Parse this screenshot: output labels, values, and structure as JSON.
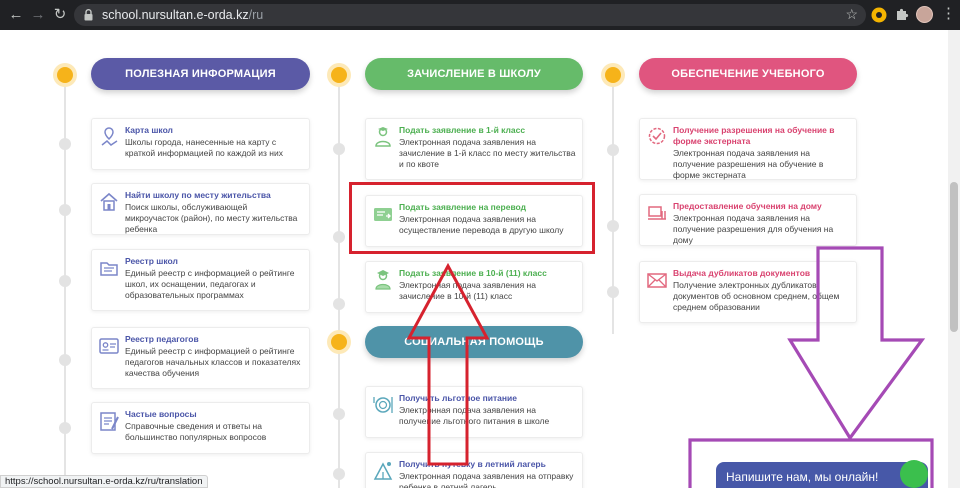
{
  "browser": {
    "url_host": "school.nursultan.e-orda.kz",
    "url_path": "/ru",
    "status_url": "https://school.nursultan.e-orda.kz/ru/translation"
  },
  "colors": {
    "blue_pill": "#5b5aa6",
    "green_pill": "#66bb6a",
    "pink_pill": "#e0557f",
    "teal_pill": "#4f93a8",
    "accent_dot": "#f6b31a",
    "red_outline": "#d6222e",
    "purple_annotation": "#a54ab5"
  },
  "columns": [
    {
      "title": "ПОЛЕЗНАЯ ИНФОРМАЦИЯ",
      "cards": [
        {
          "icon": "map-icon",
          "title": "Карта школ",
          "desc": "Школы города, нанесенные на карту с краткой информацией по каждой из них"
        },
        {
          "icon": "house-icon",
          "title": "Найти школу по месту жительства",
          "desc": "Поиск школы, обслуживающей микроучасток (район), по месту жительства ребенка"
        },
        {
          "icon": "folder-icon",
          "title": "Реестр школ",
          "desc": "Единый реестр с информацией о рейтинге школ, их оснащении, педагогах и образовательных программах"
        },
        {
          "icon": "id-card-icon",
          "title": "Реестр педагогов",
          "desc": "Единый реестр с информацией о рейтинге педагогов начальных классов и показателях качества обучения"
        },
        {
          "icon": "faq-icon",
          "title": "Частые вопросы",
          "desc": "Справочные сведения и ответы на большинство популярных вопросов"
        }
      ]
    },
    {
      "title": "ЗАЧИСЛЕНИЕ В ШКОЛУ",
      "cards": [
        {
          "icon": "student-icon",
          "title": "Подать заявление в 1-й класс",
          "desc": "Электронная подача заявления на зачисление в 1-й класс по месту жительства и по квоте"
        },
        {
          "icon": "transfer-icon",
          "title": "Подать заявление на перевод",
          "desc": "Электронная подача заявления на осуществление перевода в другую школу"
        },
        {
          "icon": "graduate-icon",
          "title": "Подать заявление в 10-й (11) класс",
          "desc": "Электронная подача заявления на зачисление в 10-й (11) класс"
        }
      ]
    },
    {
      "title": "ОБЕСПЕЧЕНИЕ УЧЕБНОГО ПРОЦЕССА",
      "cards": [
        {
          "icon": "external-study-icon",
          "title": "Получение разрешения на обучение в форме экстерната",
          "desc": "Электронная подача заявления на получение разрешения на обучение в форме экстерната"
        },
        {
          "icon": "home-study-icon",
          "title": "Предоставление обучения на дому",
          "desc": "Электронная подача заявления на получение разрешения для обучения на дому"
        },
        {
          "icon": "envelope-icon",
          "title": "Выдача дубликатов документов",
          "desc": "Получение электронных дубликатов документов об основном среднем, общем среднем образовании"
        }
      ]
    }
  ],
  "social": {
    "title": "СОЦИАЛЬНАЯ ПОМОЩЬ",
    "cards": [
      {
        "icon": "meal-icon",
        "title": "Получить льготное питание",
        "desc": "Электронная подача заявления на получение льготного питания в школе"
      },
      {
        "icon": "camp-icon",
        "title": "Получить путевку в летний лагерь",
        "desc": "Электронная подача заявления на отправку ребенка в летний лагерь"
      }
    ]
  },
  "chat": {
    "label": "Напишите нам, мы онлайн!"
  }
}
